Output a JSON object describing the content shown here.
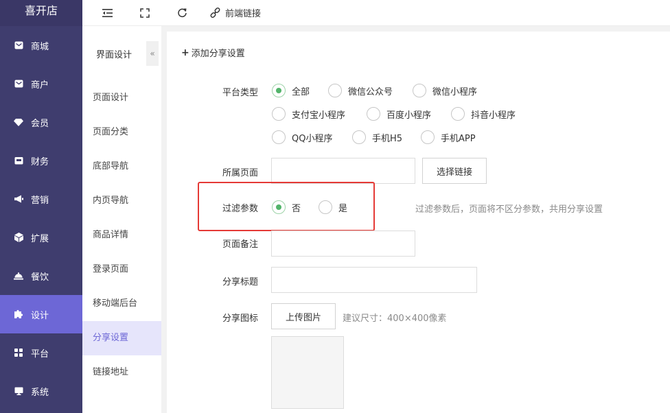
{
  "sidebar": {
    "brand": "喜开店",
    "items": [
      {
        "label": "商城",
        "icon": "mail-icon"
      },
      {
        "label": "商户",
        "icon": "mail-icon"
      },
      {
        "label": "会员",
        "icon": "diamond-icon"
      },
      {
        "label": "财务",
        "icon": "wallet-icon"
      },
      {
        "label": "营销",
        "icon": "megaphone-icon"
      },
      {
        "label": "扩展",
        "icon": "cube-icon"
      },
      {
        "label": "餐饮",
        "icon": "cloche-icon"
      },
      {
        "label": "设计",
        "icon": "puzzle-icon",
        "active": true
      },
      {
        "label": "平台",
        "icon": "grid-icon"
      },
      {
        "label": "系统",
        "icon": "monitor-icon"
      }
    ]
  },
  "topbar": {
    "link_label": "前端链接"
  },
  "subnav": {
    "title": "界面设计",
    "collapse": "«",
    "items": [
      "页面设计",
      "页面分类",
      "底部导航",
      "内页导航",
      "商品详情",
      "登录页面",
      "移动端后台",
      "分享设置",
      "链接地址"
    ],
    "active": "分享设置"
  },
  "form": {
    "add_label": "添加分享设置",
    "platform_label": "平台类型",
    "platforms": [
      "全部",
      "微信公众号",
      "微信小程序",
      "支付宝小程序",
      "百度小程序",
      "抖音小程序",
      "QQ小程序",
      "手机H5",
      "手机APP"
    ],
    "platform_selected": "全部",
    "page_label": "所属页面",
    "page_value": "",
    "choose_link": "选择链接",
    "filter_label": "过滤参数",
    "filter_options": [
      "否",
      "是"
    ],
    "filter_selected": "否",
    "filter_hint": "过滤参数后，页面将不区分参数，共用分享设置",
    "remark_label": "页面备注",
    "remark_value": "",
    "title_label": "分享标题",
    "title_value": "",
    "icon_label": "分享图标",
    "upload_label": "上传图片",
    "size_hint": "建议尺寸：400×400像素"
  },
  "colors": {
    "sidebar_bg": "#3f3d6e",
    "accent": "#6d67d6",
    "radio_on": "#52b46a",
    "highlight": "#e53935"
  }
}
